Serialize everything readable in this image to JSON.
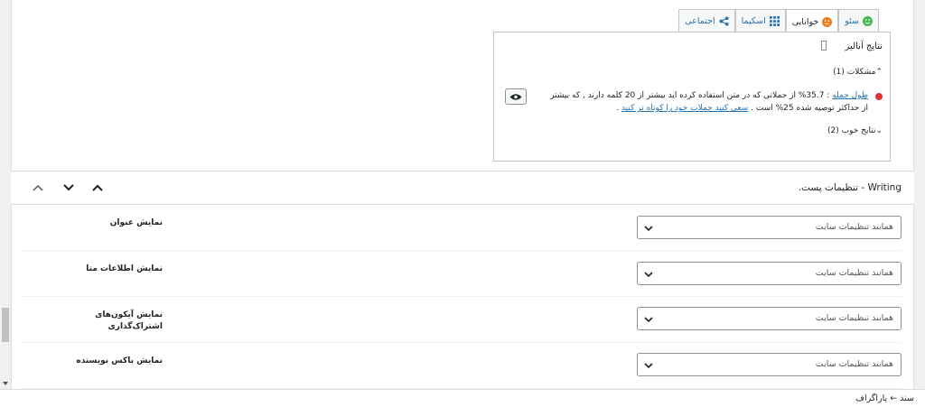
{
  "tabs": [
    {
      "label": "سئو",
      "icon": "smiley-icon",
      "color": "#46b450",
      "active": false
    },
    {
      "label": "خوانایی",
      "icon": "smiley-icon",
      "color": "#ee7c1b",
      "active": true
    },
    {
      "label": "اسکیما",
      "icon": "grid-icon",
      "color": "#2271b1",
      "active": false
    },
    {
      "label": "اجتماعی",
      "icon": "share-icon",
      "color": "#2271b1",
      "active": false
    }
  ],
  "analysis": {
    "title": "نتایج آنالیز",
    "problems_label": "مشکلات (1)",
    "issue_link": "طول جمله",
    "issue_text": " : 35.7% از جملاتی که در متن استفاده کرده اید بیشتر از 20 کلمه دارند , که بیشتر از حداکثر توصیه شده 25% است . ",
    "issue_action": "سعی کنید جملات خود را کوتاه تر کنید",
    "issue_action_end": " .",
    "good_label": "نتایج خوب (2)",
    "issue_color": "#dc3232"
  },
  "section": {
    "title": "Writing - تنظیمات پست."
  },
  "settings": [
    {
      "label": "نمایش عنوان",
      "value": "همانند تنظیمات سایت"
    },
    {
      "label": "نمایش اطلاعات متا",
      "value": "همانند تنظیمات سایت"
    },
    {
      "label": "نمایش آیکون‌های اشتراک‌گذاری",
      "value": "همانند تنظیمات سایت"
    },
    {
      "label": "نمایش باکس نویسنده",
      "value": "همانند تنظیمات سایت"
    }
  ],
  "statusbar": {
    "text": "سند  ←  پاراگراف"
  }
}
